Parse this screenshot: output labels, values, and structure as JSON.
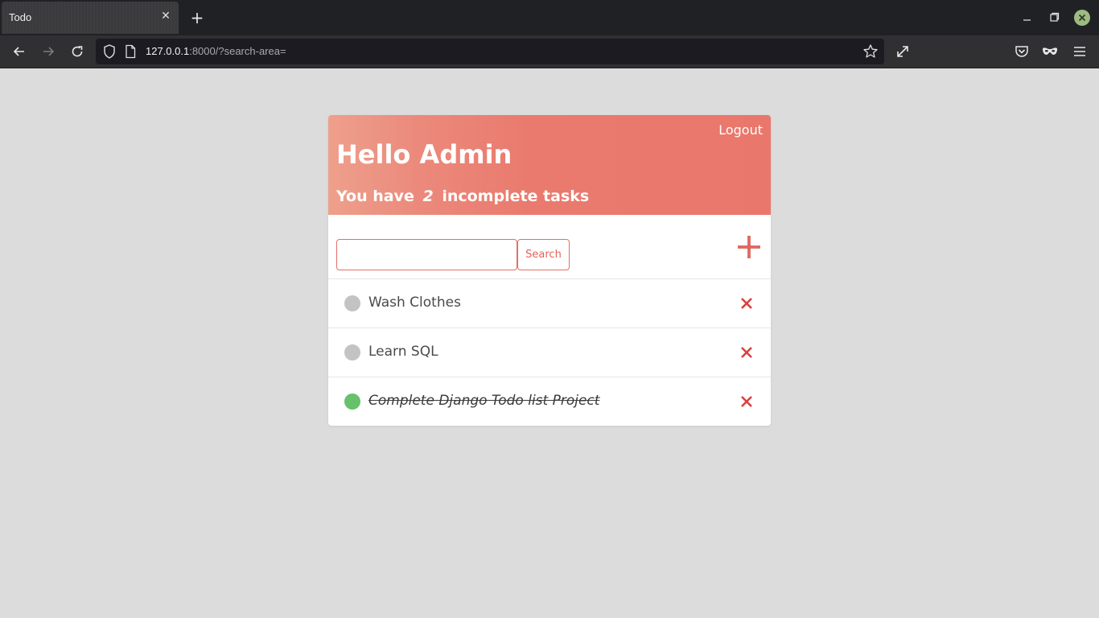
{
  "browser": {
    "tab_title": "Todo",
    "tab_close": "✕",
    "new_tab": "+",
    "url_host": "127.0.0.1",
    "url_rest": ":8000/?search-area="
  },
  "header": {
    "logout_label": "Logout",
    "greeting": "Hello Admin",
    "subtitle_prefix": "You have",
    "incomplete_count": "2",
    "subtitle_suffix": "incomplete tasks"
  },
  "search": {
    "value": "",
    "placeholder": "",
    "button_label": "Search"
  },
  "tasks": [
    {
      "title": "Wash Clothes",
      "complete": false
    },
    {
      "title": "Learn SQL",
      "complete": false
    },
    {
      "title": "Complete Django Todo list Project",
      "complete": true
    }
  ],
  "colors": {
    "accent": "#e26f66",
    "header_start": "#eea08c",
    "header_end": "#ea776c",
    "complete_dot": "#66c16a",
    "incomplete_dot": "#c3c3c3",
    "delete": "#d94040",
    "page_bg": "#dcdcdc"
  },
  "icons": {
    "add": "plus-icon",
    "delete": "close-icon",
    "reload": "reload-icon"
  }
}
